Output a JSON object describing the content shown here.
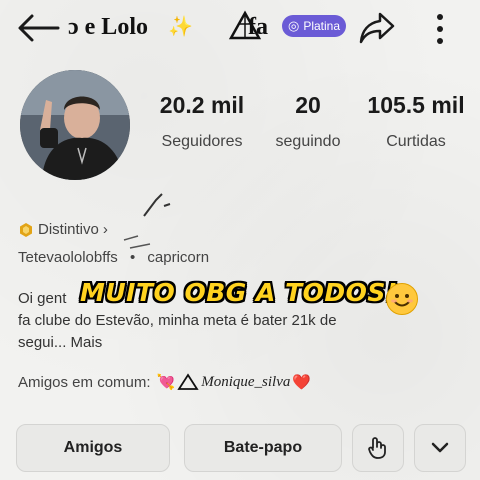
{
  "header": {
    "name": "ɔ e Lolo",
    "sparkle": "✨",
    "name_suffix": "fa",
    "badge_label": "Platina",
    "badge_color": "#6b5bd6"
  },
  "stats": [
    {
      "value": "20.2 mil",
      "label": "Seguidores"
    },
    {
      "value": "20",
      "label": "seguindo"
    },
    {
      "value": "105.5 mil",
      "label": "Curtidas"
    }
  ],
  "badge_row": {
    "label": "Distintivo",
    "chevron": "›"
  },
  "info_row": {
    "username": "Tetevaololobffs",
    "separator": "•",
    "sign": "capricorn"
  },
  "bio": {
    "line1": "Oi gent",
    "line2": "fa clube do Estevão, minha meta é bater 21k de",
    "line3": "segui...",
    "more": "Mais"
  },
  "overlay_text": "MUITO OBG A TODOS!",
  "mutual": {
    "label": "Amigos em comum:",
    "name": "Monique_silva",
    "heart": "❤️",
    "heart_left": "💘"
  },
  "buttons": {
    "friends": "Amigos",
    "chat": "Bate-papo"
  },
  "icons": [
    "back-arrow-icon",
    "triangle-icon",
    "platina-badge-icon",
    "share-icon",
    "more-vertical-icon",
    "hexagon-badge-icon",
    "hand-wave-icon",
    "chevron-down-icon",
    "smile-emoji-icon"
  ]
}
